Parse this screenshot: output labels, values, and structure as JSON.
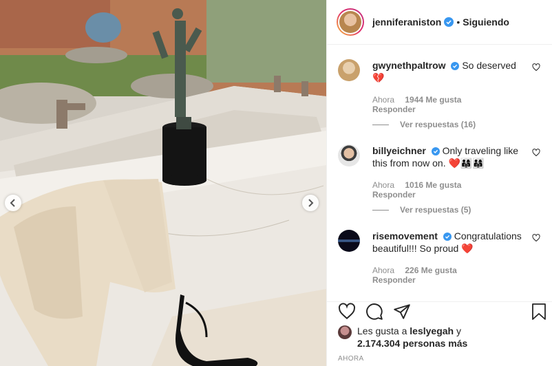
{
  "post": {
    "username": "jenniferaniston",
    "separator": "•",
    "follow_label": "Siguiendo"
  },
  "comments": [
    {
      "username": "gwynethpaltrow",
      "text": "So deserved",
      "emoji": "💔",
      "time": "Ahora",
      "likes": "1944 Me gusta",
      "reply": "Responder",
      "view_replies": "Ver respuestas (16)"
    },
    {
      "username": "billyeichner",
      "text": "Only traveling like this from now on.",
      "emoji": "❤️👨‍👩‍👧👨‍👩‍👧",
      "time": "Ahora",
      "likes": "1016 Me gusta",
      "reply": "Responder",
      "view_replies": "Ver respuestas (5)"
    },
    {
      "username": "risemovement",
      "text": "Congratulations beautiful!!! So proud",
      "emoji": "❤️",
      "time": "Ahora",
      "likes": "226 Me gusta",
      "reply": "Responder"
    }
  ],
  "likes": {
    "prefix": "Les gusta a",
    "user": "leslyegah",
    "conj": "y",
    "count": "2.174.304 personas más"
  },
  "timestamp": "AHORA",
  "colors": {
    "verified": "#3897f0",
    "heart_red": "#ed4956",
    "muted": "#8e8e8e"
  },
  "icons": [
    "chevron-left-icon",
    "chevron-right-icon",
    "verified-icon",
    "heart-icon",
    "comment-icon",
    "share-icon",
    "bookmark-icon"
  ]
}
